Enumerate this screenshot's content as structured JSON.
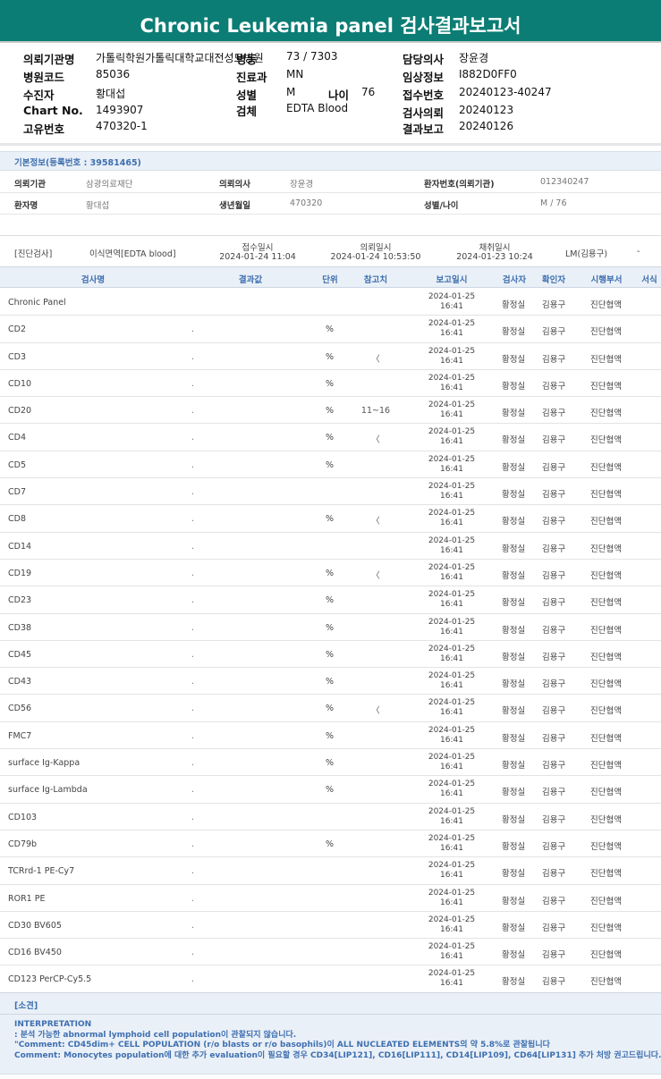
{
  "title": "Chronic Leukemia panel 검사결과보고서",
  "info": {
    "hospital_label": "의뢰기관명",
    "hospital_value": "가톨릭학원가톨릭대학교대전성모병원",
    "ward_label": "병동",
    "ward_value": "73 / 7303",
    "doctor_label": "담당의사",
    "doctor_value": "장윤경",
    "code_label": "병원코드",
    "code_value": "85036",
    "dept_label": "진료과",
    "dept_value": "MN",
    "clinical_label": "임상정보",
    "clinical_value": "I882D0FF0",
    "patient_label": "수진자",
    "patient_value": "황대섭",
    "sex_label": "성별",
    "sex_value": "M",
    "age_label": "나이",
    "age_value": "76",
    "accession_label": "접수번호",
    "accession_value": "20240123-40247",
    "chart_label": "Chart No.",
    "chart_value": "1493907",
    "specimen_label": "검체",
    "specimen_value": "EDTA Blood",
    "request_label": "검사의뢰",
    "request_value": "20240123",
    "uid_label": "고유번호",
    "uid_value": "470320-1",
    "report_label": "결과보고",
    "report_value": "20240126"
  },
  "basic": {
    "header": "기본정보(등록번호 : 39581465)",
    "row1": {
      "l1": "의뢰기관",
      "v1": "삼광의료재단",
      "l2": "의뢰의사",
      "v2": "장윤경",
      "l3": "환자번호(의뢰기관)",
      "v3": "012340247"
    },
    "row2": {
      "l1": "환자명",
      "v1": "황대섭",
      "l2": "생년월일",
      "v2": "470320",
      "l3": "성별/나이",
      "v3": "M / 76"
    }
  },
  "dx": {
    "tag": "[진단검사]",
    "specimen": "이식면역[EDTA blood]",
    "recv_label": "접수일시",
    "recv_value": "2024-01-24 11:04",
    "req_label": "의뢰일시",
    "req_value": "2024-01-24 10:53:50",
    "col_label": "채취일시",
    "col_value": "2024-01-23 10:24",
    "lm": "LM(김용구)",
    "dash": "-"
  },
  "table": {
    "headers": [
      "검사명",
      "결과값",
      "단위",
      "참고치",
      "보고일시",
      "검사자",
      "확인자",
      "시행부서",
      "서식"
    ],
    "rows": [
      {
        "name": "Chronic Panel",
        "result": "",
        "unit": "",
        "ref": "",
        "date": "2024-01-25",
        "time": "16:41",
        "tester": "황정실",
        "checker": "김용구",
        "dept": "진단협액"
      },
      {
        "name": "CD2",
        "result": ".",
        "unit": "%",
        "ref": "",
        "date": "2024-01-25",
        "time": "16:41",
        "tester": "황정실",
        "checker": "김용구",
        "dept": "진단협액"
      },
      {
        "name": "CD3",
        "result": ".",
        "unit": "%",
        "ref": "〈",
        "date": "2024-01-25",
        "time": "16:41",
        "tester": "황정실",
        "checker": "김용구",
        "dept": "진단협액"
      },
      {
        "name": "CD10",
        "result": ".",
        "unit": "%",
        "ref": "",
        "date": "2024-01-25",
        "time": "16:41",
        "tester": "황정실",
        "checker": "김용구",
        "dept": "진단협액"
      },
      {
        "name": "CD20",
        "result": ".",
        "unit": "%",
        "ref": "11~16",
        "date": "2024-01-25",
        "time": "16:41",
        "tester": "황정실",
        "checker": "김용구",
        "dept": "진단협액"
      },
      {
        "name": "CD4",
        "result": ".",
        "unit": "%",
        "ref": "〈",
        "date": "2024-01-25",
        "time": "16:41",
        "tester": "황정실",
        "checker": "김용구",
        "dept": "진단협액"
      },
      {
        "name": "CD5",
        "result": ".",
        "unit": "%",
        "ref": "",
        "date": "2024-01-25",
        "time": "16:41",
        "tester": "황정실",
        "checker": "김용구",
        "dept": "진단협액"
      },
      {
        "name": "CD7",
        "result": ".",
        "unit": "",
        "ref": "",
        "date": "2024-01-25",
        "time": "16:41",
        "tester": "황정실",
        "checker": "김용구",
        "dept": "진단협액"
      },
      {
        "name": "CD8",
        "result": ".",
        "unit": "%",
        "ref": "〈",
        "date": "2024-01-25",
        "time": "16:41",
        "tester": "황정실",
        "checker": "김용구",
        "dept": "진단협액"
      },
      {
        "name": "CD14",
        "result": ".",
        "unit": "",
        "ref": "",
        "date": "2024-01-25",
        "time": "16:41",
        "tester": "황정실",
        "checker": "김용구",
        "dept": "진단협액"
      },
      {
        "name": "CD19",
        "result": ".",
        "unit": "%",
        "ref": "〈",
        "date": "2024-01-25",
        "time": "16:41",
        "tester": "황정실",
        "checker": "김용구",
        "dept": "진단협액"
      },
      {
        "name": "CD23",
        "result": ".",
        "unit": "%",
        "ref": "",
        "date": "2024-01-25",
        "time": "16:41",
        "tester": "황정실",
        "checker": "김용구",
        "dept": "진단협액"
      },
      {
        "name": "CD38",
        "result": ".",
        "unit": "%",
        "ref": "",
        "date": "2024-01-25",
        "time": "16:41",
        "tester": "황정실",
        "checker": "김용구",
        "dept": "진단협액"
      },
      {
        "name": "CD45",
        "result": ".",
        "unit": "%",
        "ref": "",
        "date": "2024-01-25",
        "time": "16:41",
        "tester": "황정실",
        "checker": "김용구",
        "dept": "진단협액"
      },
      {
        "name": "CD43",
        "result": ".",
        "unit": "%",
        "ref": "",
        "date": "2024-01-25",
        "time": "16:41",
        "tester": "황정실",
        "checker": "김용구",
        "dept": "진단협액"
      },
      {
        "name": "CD56",
        "result": ".",
        "unit": "%",
        "ref": "〈",
        "date": "2024-01-25",
        "time": "16:41",
        "tester": "황정실",
        "checker": "김용구",
        "dept": "진단협액"
      },
      {
        "name": "FMC7",
        "result": ".",
        "unit": "%",
        "ref": "",
        "date": "2024-01-25",
        "time": "16:41",
        "tester": "황정실",
        "checker": "김용구",
        "dept": "진단협액"
      },
      {
        "name": "surface Ig-Kappa",
        "result": ".",
        "unit": "%",
        "ref": "",
        "date": "2024-01-25",
        "time": "16:41",
        "tester": "황정실",
        "checker": "김용구",
        "dept": "진단협액"
      },
      {
        "name": "surface Ig-Lambda",
        "result": ".",
        "unit": "%",
        "ref": "",
        "date": "2024-01-25",
        "time": "16:41",
        "tester": "황정실",
        "checker": "김용구",
        "dept": "진단협액"
      },
      {
        "name": "CD103",
        "result": ".",
        "unit": "",
        "ref": "",
        "date": "2024-01-25",
        "time": "16:41",
        "tester": "황정실",
        "checker": "김용구",
        "dept": "진단협액"
      },
      {
        "name": "CD79b",
        "result": ".",
        "unit": "%",
        "ref": "",
        "date": "2024-01-25",
        "time": "16:41",
        "tester": "황정실",
        "checker": "김용구",
        "dept": "진단협액"
      },
      {
        "name": "TCRrd-1 PE-Cy7",
        "result": ".",
        "unit": "",
        "ref": "",
        "date": "2024-01-25",
        "time": "16:41",
        "tester": "황정실",
        "checker": "김용구",
        "dept": "진단협액"
      },
      {
        "name": "ROR1 PE",
        "result": ".",
        "unit": "",
        "ref": "",
        "date": "2024-01-25",
        "time": "16:41",
        "tester": "황정실",
        "checker": "김용구",
        "dept": "진단협액"
      },
      {
        "name": "CD30 BV605",
        "result": ".",
        "unit": "",
        "ref": "",
        "date": "2024-01-25",
        "time": "16:41",
        "tester": "황정실",
        "checker": "김용구",
        "dept": "진단협액"
      },
      {
        "name": "CD16 BV450",
        "result": ".",
        "unit": "",
        "ref": "",
        "date": "2024-01-25",
        "time": "16:41",
        "tester": "황정실",
        "checker": "김용구",
        "dept": "진단협액"
      },
      {
        "name": "CD123 PerCP-Cy5.5",
        "result": ".",
        "unit": "",
        "ref": "",
        "date": "2024-01-25",
        "time": "16:41",
        "tester": "황정실",
        "checker": "김용구",
        "dept": "진단협액"
      }
    ]
  },
  "findings": {
    "header": "[소견]",
    "lines": [
      "INTERPRETATION",
      ": 분석 가능한 abnormal lymphoid cell population이 관찰되지 않습니다.",
      "\"Comment: CD45dim+ CELL POPULATION (r/o blasts or r/o basophils)이 ALL NUCLEATED ELEMENTS의 약 5.8%로 관찰됩니다",
      "Comment: Monocytes population에 대한 추가 evaluation이 필요할 경우 CD34[LIP121], CD16[LIP111], CD14[LIP109], CD64[LIP131] 추가 처방 권고드립니다. \""
    ]
  },
  "colors": {
    "header_bg": "#0b7d74",
    "accent_text": "#3e6fb0",
    "band_bg": "#eaf0f7"
  }
}
